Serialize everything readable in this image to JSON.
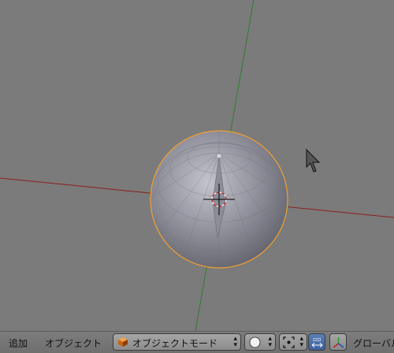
{
  "header": {
    "menu_add": "追加",
    "menu_object": "オブジェクト",
    "mode_label": "オブジェクトモード",
    "orientation_label": "グローバル"
  },
  "viewport": {
    "selected_outline_color": "#f0a030",
    "x_axis_color": "#8c1e1e",
    "y_axis_color": "#2e7d2e",
    "background_color": "#7b7b7b"
  },
  "icons": {
    "mode_icon": "cube-object-icon",
    "shading_icon": "solid-sphere-icon",
    "pivot_icon": "bounding-box-center-icon",
    "manipulator_icon": "transform-manipulator-icon",
    "cursor": "mouse-pointer-icon"
  }
}
